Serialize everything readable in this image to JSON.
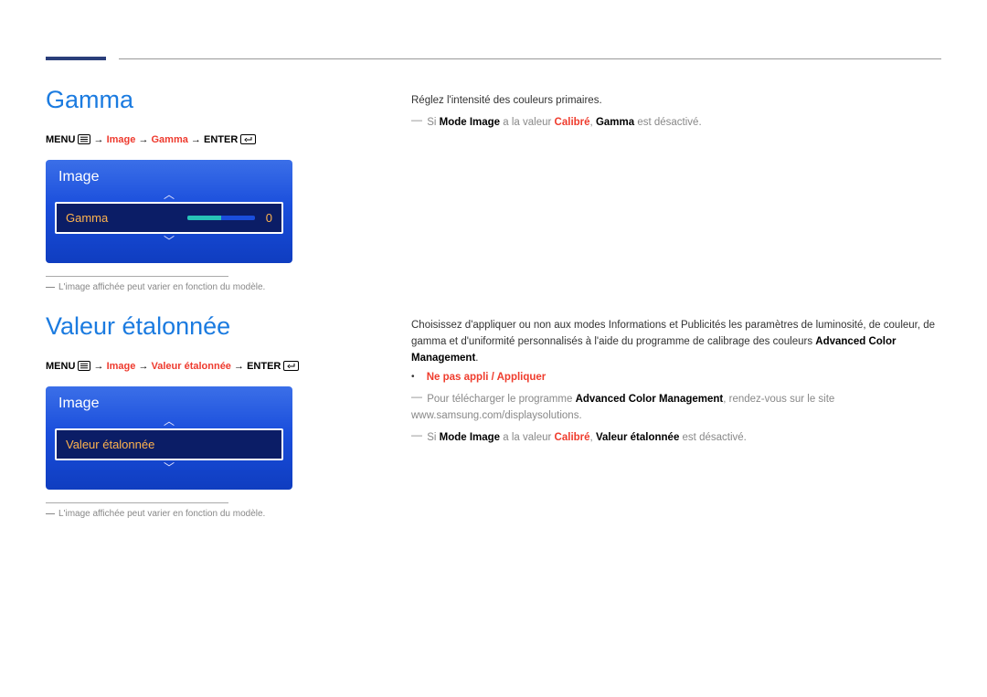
{
  "section1": {
    "title": "Gamma",
    "breadcrumb": {
      "menu": "MENU",
      "path1": "Image",
      "path2": "Gamma",
      "enter": "ENTER",
      "arrow": "→"
    },
    "osd": {
      "title": "Image",
      "row_label": "Gamma",
      "row_value": "0"
    },
    "footnote": "L'image affichée peut varier en fonction du modèle.",
    "body": {
      "desc": "Réglez l'intensité des couleurs primaires.",
      "note_prefix_si": "Si ",
      "note_mode": "Mode Image",
      "note_mid": " a la valeur ",
      "note_cal": "Calibré",
      "note_sep": ", ",
      "note_gamma": "Gamma",
      "note_suffix": " est désactivé."
    }
  },
  "section2": {
    "title": "Valeur étalonnée",
    "breadcrumb": {
      "menu": "MENU",
      "path1": "Image",
      "path2": "Valeur étalonnée",
      "enter": "ENTER",
      "arrow": "→"
    },
    "osd": {
      "title": "Image",
      "row_label": "Valeur étalonnée"
    },
    "footnote": "L'image affichée peut varier en fonction du modèle.",
    "body": {
      "p1a": "Choisissez d'appliquer ou non aux modes Informations et Publicités les paramètres de luminosité, de couleur, de gamma et d'uniformité personnalisés à l'aide du programme de calibrage des couleurs ",
      "p1b": "Advanced Color Management",
      "p1c": ".",
      "options": "Ne pas appli / Appliquer",
      "n1a": "Pour télécharger le programme ",
      "n1b": "Advanced Color Management",
      "n1c": ", rendez-vous sur le site www.samsung.com/displaysolutions.",
      "n2_si": "Si ",
      "n2_mode": "Mode Image",
      "n2_mid": " a la valeur ",
      "n2_cal": "Calibré",
      "n2_sep": ", ",
      "n2_val": "Valeur étalonnée",
      "n2_suffix": " est désactivé."
    }
  }
}
